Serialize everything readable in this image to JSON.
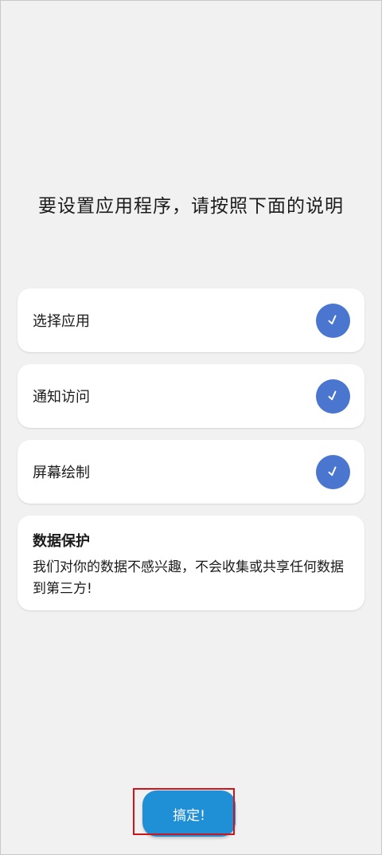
{
  "title": "要设置应用程序，请按照下面的说明",
  "steps": [
    {
      "label": "选择应用",
      "icon": "check-icon",
      "checked": true
    },
    {
      "label": "通知访问",
      "icon": "check-icon",
      "checked": true
    },
    {
      "label": "屏幕绘制",
      "icon": "check-icon",
      "checked": true
    }
  ],
  "privacy": {
    "title": "数据保护",
    "text": "我们对你的数据不感兴趣，不会收集或共享任何数据到第三方!"
  },
  "done_button": {
    "label": "搞定!"
  },
  "colors": {
    "background": "#f1f1f1",
    "card": "#ffffff",
    "check": "#4a76d0",
    "button": "#1f8fd6",
    "highlight": "#d0141c"
  }
}
